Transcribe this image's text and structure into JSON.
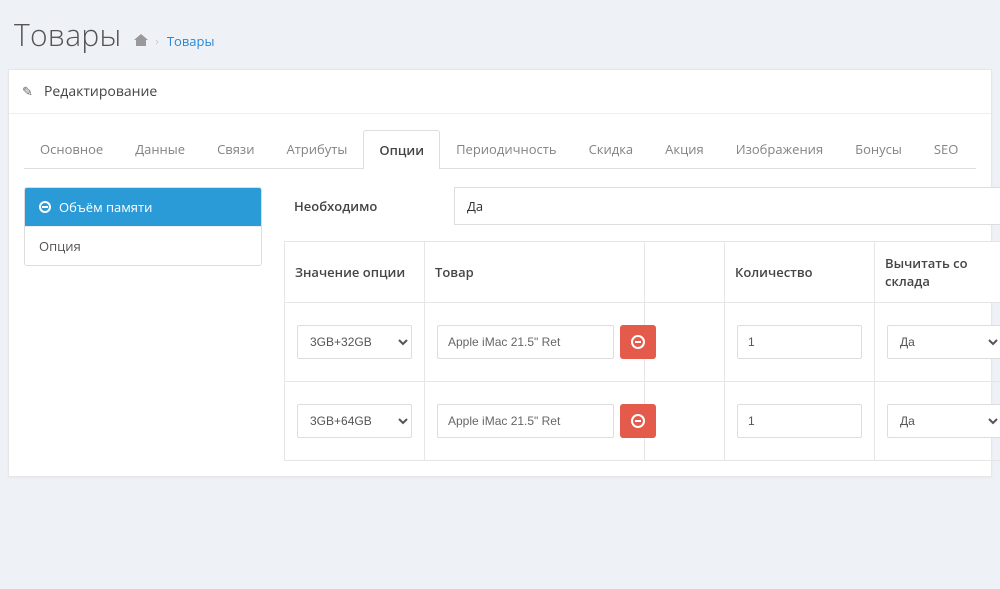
{
  "pageTitle": "Товары",
  "breadcrumb": {
    "current": "Товары"
  },
  "panelHeading": "Редактирование",
  "tabs": [
    {
      "label": "Основное",
      "active": false
    },
    {
      "label": "Данные",
      "active": false
    },
    {
      "label": "Связи",
      "active": false
    },
    {
      "label": "Атрибуты",
      "active": false
    },
    {
      "label": "Опции",
      "active": true
    },
    {
      "label": "Периодичность",
      "active": false
    },
    {
      "label": "Скидка",
      "active": false
    },
    {
      "label": "Акция",
      "active": false
    },
    {
      "label": "Изображения",
      "active": false
    },
    {
      "label": "Бонусы",
      "active": false
    },
    {
      "label": "SEO",
      "active": false
    }
  ],
  "optionList": {
    "activeLabel": "Объём памяти",
    "addLabel": "Опция"
  },
  "required": {
    "label": "Необходимо",
    "value": "Да"
  },
  "table": {
    "headers": {
      "optionValue": "Значение опции",
      "product": "Товар",
      "quantity": "Количество",
      "subtract": "Вычитать со склада"
    },
    "rows": [
      {
        "optionValue": "3GB+32GB",
        "product": "Apple iMac 21.5\" Ret",
        "quantity": "1",
        "subtract": "Да"
      },
      {
        "optionValue": "3GB+64GB",
        "product": "Apple iMac 21.5\" Ret",
        "quantity": "1",
        "subtract": "Да"
      }
    ]
  }
}
